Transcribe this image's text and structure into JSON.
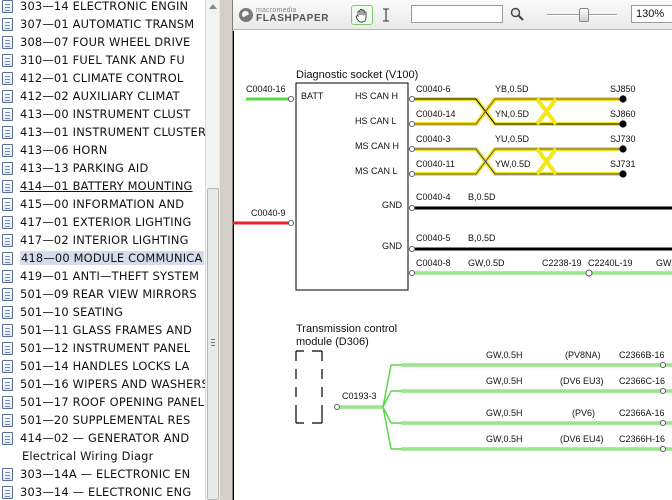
{
  "tree": {
    "items": [
      {
        "label": "303—14 ELECTRONIC ENGIN",
        "style": "icon"
      },
      {
        "label": "307—01 AUTOMATIC TRANSM",
        "style": "icon"
      },
      {
        "label": "308—07 FOUR WHEEL DRIVE",
        "style": "icon"
      },
      {
        "label": "310—01 FUEL TANK AND FU",
        "style": "icon"
      },
      {
        "label": "412—01 CLIMATE CONTROL",
        "style": "icon"
      },
      {
        "label": "412—02 AUXILIARY CLIMAT",
        "style": "icon"
      },
      {
        "label": "413—00 INSTRUMENT CLUST",
        "style": "icon"
      },
      {
        "label": "413—01 INSTRUMENT CLUSTER",
        "style": "icon"
      },
      {
        "label": "413—06 HORN",
        "style": "icon"
      },
      {
        "label": "413—13 PARKING AID",
        "style": "icon"
      },
      {
        "label": "414—01 BATTERY MOUNTING",
        "style": "underline"
      },
      {
        "label": "415—00 INFORMATION AND",
        "style": "icon"
      },
      {
        "label": "417—01 EXTERIOR LIGHTING",
        "style": "icon"
      },
      {
        "label": "417—02 INTERIOR LIGHTING",
        "style": "icon"
      },
      {
        "label": "418—00 MODULE COMMUNICA",
        "style": "selected"
      },
      {
        "label": "419—01 ANTI—THEFT SYSTEM",
        "style": "icon"
      },
      {
        "label": "501—09 REAR VIEW MIRRORS",
        "style": "icon"
      },
      {
        "label": "501—10 SEATING",
        "style": "icon"
      },
      {
        "label": "501—11 GLASS FRAMES AND",
        "style": "icon"
      },
      {
        "label": "501—12 INSTRUMENT PANEL",
        "style": "icon"
      },
      {
        "label": "501—14 HANDLES LOCKS LA",
        "style": "icon"
      },
      {
        "label": "501—16 WIPERS AND WASHERS",
        "style": "icon"
      },
      {
        "label": "501—17 ROOF OPENING PANEL",
        "style": "icon"
      },
      {
        "label": "501—20 SUPPLEMENTAL RES",
        "style": "icon"
      },
      {
        "label": "414—02 — GENERATOR AND",
        "style": "icon"
      },
      {
        "label": "Electrical Wiring Diagr",
        "style": "plain"
      },
      {
        "label": "303—14A — ELECTRONIC EN",
        "style": "icon"
      },
      {
        "label": "303—14 — ELECTRONIC ENG",
        "style": "icon"
      }
    ]
  },
  "viewer": {
    "logo_brand": "macromedia",
    "logo_product": "FLASHPAPER",
    "search_value": "",
    "zoom": "130%"
  },
  "diagram": {
    "socket_title": "Diagnostic socket (V100)",
    "socket_pins": {
      "batt": "BATT",
      "hs_can_h": "HS CAN H",
      "hs_can_l": "HS CAN L",
      "ms_can_h": "MS CAN H",
      "ms_can_l": "MS CAN L",
      "gnd1": "GND",
      "gnd2": "GND"
    },
    "batt_wire": "C0040-16",
    "left_wire_2": "C0040-9",
    "wires": [
      {
        "conn": "C0040-6",
        "spec": "YB,0.5D",
        "splice": "SJ850"
      },
      {
        "conn": "C0040-14",
        "spec": "YN,0.5D",
        "splice": "SJ860"
      },
      {
        "conn": "C0040-3",
        "spec": "YU,0.5D",
        "splice": "SJ730"
      },
      {
        "conn": "C0040-11",
        "spec": "YW,0.5D",
        "splice": "SJ731"
      },
      {
        "conn": "C0040-4",
        "spec": "B,0.5D"
      },
      {
        "conn": "C0040-5",
        "spec": "B,0.5D"
      },
      {
        "conn": "C0040-8",
        "spec": "GW,0.5D",
        "far1": "C2238-19",
        "far2": "C2240L-19",
        "far3": "GW"
      }
    ],
    "tcm_title_1": "Transmission control",
    "tcm_title_2": "module (D306)",
    "tcm_conn": "C0193-3",
    "tcm_wires": [
      {
        "spec": "GW,0.5H",
        "variant": "(PV8NA)",
        "conn": "C2366B-16"
      },
      {
        "spec": "GW,0.5H",
        "variant": "(DV6 EU3)",
        "conn": "C2366C-16"
      },
      {
        "spec": "GW,0.5H",
        "variant": "(PV6)",
        "conn": "C2366A-16"
      },
      {
        "spec": "GW,0.5H",
        "variant": "(DV6 EU4)",
        "conn": "C2366H-16"
      }
    ],
    "colors": {
      "green": "#5cd64a",
      "red": "#e8232a",
      "yellow": "#f4e61c",
      "black": "#000000"
    }
  }
}
